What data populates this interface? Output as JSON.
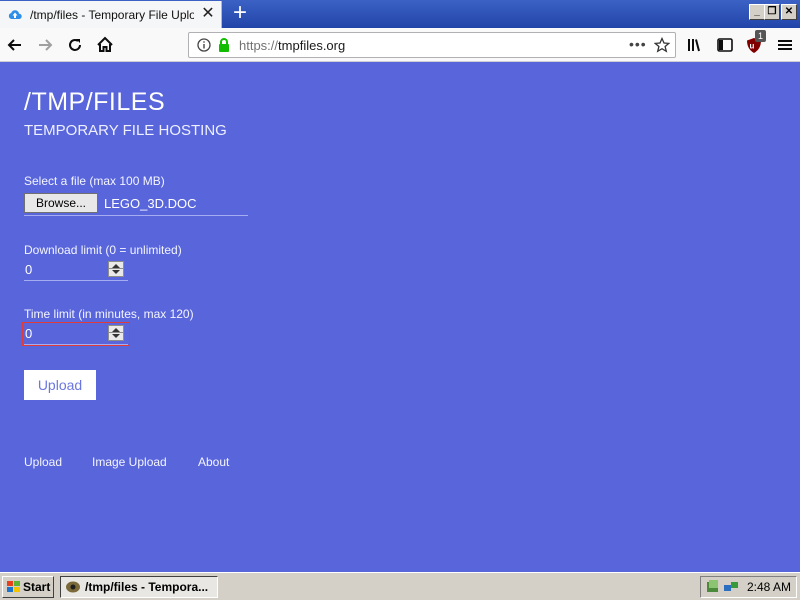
{
  "browser": {
    "tab_title": "/tmp/files - Temporary File Upload",
    "url_scheme": "https://",
    "url_host": "tmpfiles.org",
    "badge_count": "1",
    "colors": {
      "tabstrip": "#2a4fb0",
      "lock": "#12bc00",
      "ublock": "#800000"
    }
  },
  "page": {
    "title": "/TMP/FILES",
    "subtitle": "TEMPORARY FILE HOSTING",
    "file_label": "Select a file (max 100 MB)",
    "browse_label": "Browse...",
    "file_name": "LEGO_3D.DOC",
    "download_label": "Download limit (0 = unlimited)",
    "download_value": "0",
    "time_label": "Time limit (in minutes, max 120)",
    "time_value": "0",
    "upload_label": "Upload",
    "footer": {
      "upload": "Upload",
      "image_upload": "Image Upload",
      "about": "About"
    },
    "colors": {
      "background": "#5865db"
    }
  },
  "taskbar": {
    "start_label": "Start",
    "task_label": "/tmp/files - Tempora...",
    "clock": "2:48 AM"
  }
}
